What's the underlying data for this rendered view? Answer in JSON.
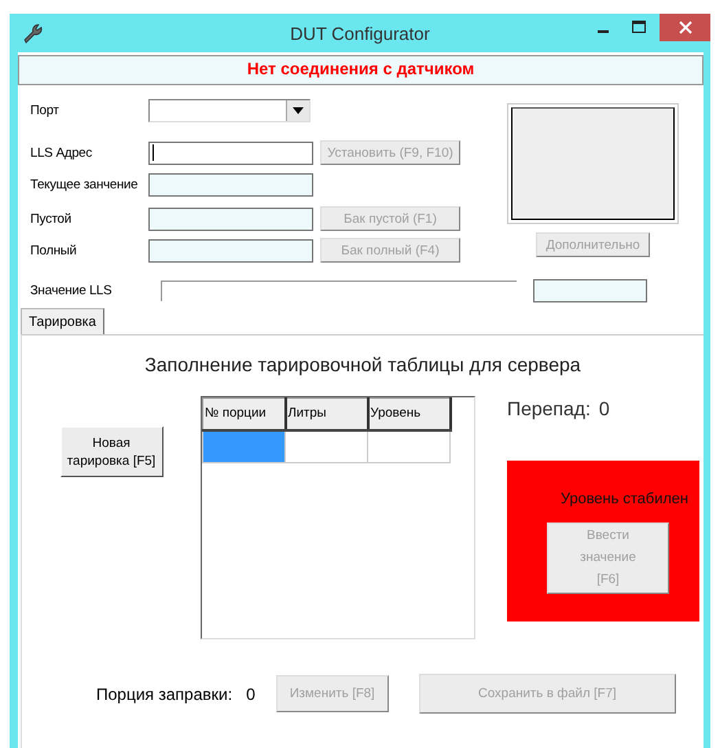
{
  "window": {
    "title": "DUT Configurator"
  },
  "status_banner": "Нет соединения с датчиком",
  "fields": [
    {
      "label": "Порт",
      "kind": "dropdown"
    },
    {
      "label": "LLS Адрес",
      "kind": "input",
      "button": {
        "label": "Установить (F9, F10)",
        "disabled": true
      }
    },
    {
      "label": "Текущее занчение",
      "kind": "readonly"
    },
    {
      "label": "Пустой",
      "kind": "readonly",
      "button": {
        "label": "Бак пустой (F1)",
        "disabled": true
      }
    },
    {
      "label": "Полный",
      "kind": "readonly",
      "button": {
        "label": "Бак полный (F4)",
        "disabled": true
      }
    }
  ],
  "extra_button": {
    "label": "Дополнительно",
    "disabled": true
  },
  "lls_value": {
    "label": "Значение LLS"
  },
  "tabs": [
    {
      "label": "Тарировка",
      "selected": true
    }
  ],
  "calibration": {
    "title": "Заполнение тарировочной таблицы для сервера",
    "new_button": {
      "label": "Новая тарировка [F5]",
      "disabled": false
    },
    "table": {
      "columns": [
        "№ порции",
        "Литры",
        "Уровень"
      ],
      "rows": [
        {
          "selected": true
        }
      ]
    },
    "drop": {
      "label": "Перепад:",
      "value": "0"
    },
    "stability": {
      "text": "Уровень стабилен"
    },
    "enter_button": {
      "label": "Ввести значение [F6]",
      "disabled": true
    },
    "portion": {
      "label": "Порция заправки:",
      "value": "0"
    },
    "bottom_buttons": [
      {
        "label": "Изменить [F8]",
        "disabled": true
      },
      {
        "label": "Сохранить в файл [F7]",
        "disabled": true
      }
    ]
  }
}
